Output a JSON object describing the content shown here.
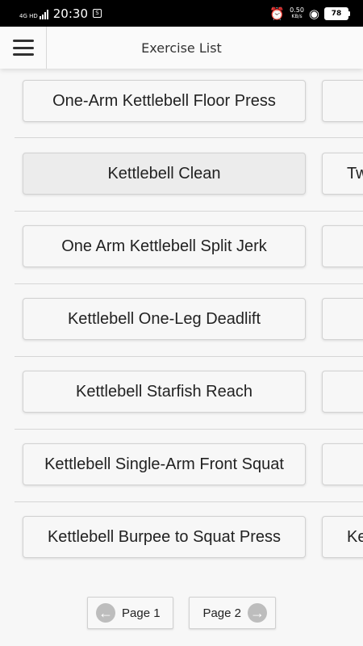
{
  "status_bar": {
    "time": "20:30",
    "network_text": "4G HD",
    "speed_value": "0.50",
    "speed_unit": "KB/s",
    "battery": "78"
  },
  "app_bar": {
    "title": "Exercise List"
  },
  "exercises": [
    {
      "label": "One-Arm Kettlebell Floor Press",
      "peek_label": ""
    },
    {
      "label": "Kettlebell Clean",
      "peek_label": "Tw"
    },
    {
      "label": "One Arm Kettlebell Split Jerk",
      "peek_label": ""
    },
    {
      "label": "Kettlebell One-Leg Deadlift",
      "peek_label": ""
    },
    {
      "label": "Kettlebell Starfish Reach",
      "peek_label": ""
    },
    {
      "label": "Kettlebell Single-Arm Front Squat",
      "peek_label": ""
    },
    {
      "label": "Kettlebell Burpee to Squat Press",
      "peek_label": "Ket"
    }
  ],
  "pagination": {
    "prev_label": "Page 1",
    "next_label": "Page 2",
    "prev_icon": "arrow-left-circle-icon",
    "next_icon": "arrow-right-circle-icon"
  },
  "icons": {
    "menu": "hamburger-menu-icon",
    "signal": "signal-icon",
    "alarm": "alarm-icon",
    "wifi": "wifi-icon",
    "battery": "battery-icon"
  },
  "colors": {
    "status_bar": "#000000",
    "background": "#f7f7f7",
    "button_border": "#d2d2d2",
    "pagination_icon": "#bdbdbd"
  }
}
